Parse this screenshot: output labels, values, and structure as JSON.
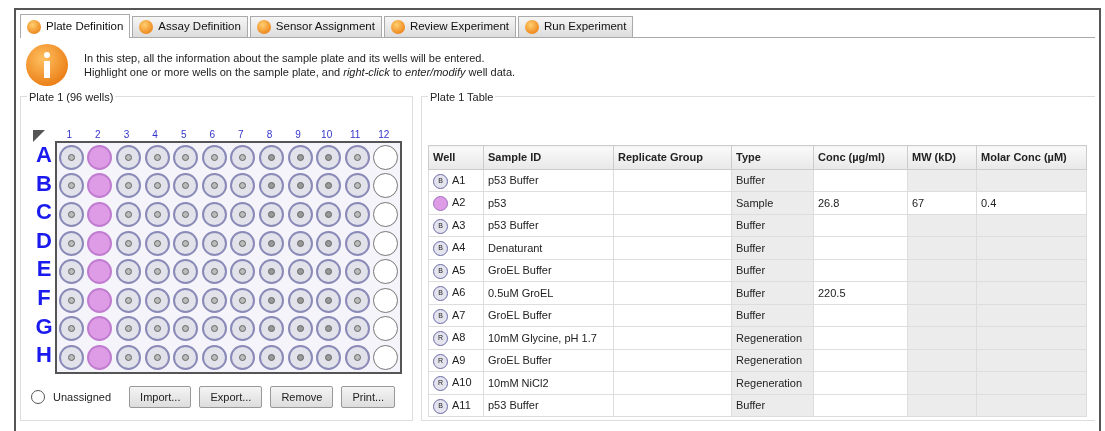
{
  "tabs": [
    {
      "label": "Plate Definition",
      "selected": true
    },
    {
      "label": "Assay Definition",
      "selected": false
    },
    {
      "label": "Sensor Assignment",
      "selected": false
    },
    {
      "label": "Review Experiment",
      "selected": false
    },
    {
      "label": "Run Experiment",
      "selected": false
    }
  ],
  "info": {
    "lines": [
      "In this step, all the information about the sample plate and its wells will be entered.",
      "Highlight one or more wells on the sample plate, and *right-click* to *enter/modify* well data."
    ]
  },
  "plate": {
    "title": "Plate 1 (96 wells)",
    "column_labels": [
      "1",
      "2",
      "3",
      "4",
      "5",
      "6",
      "7",
      "8",
      "9",
      "10",
      "11",
      "12"
    ],
    "row_labels": [
      "A",
      "B",
      "C",
      "D",
      "E",
      "F",
      "G",
      "H"
    ],
    "well_columns": [
      {
        "kind": "buffer"
      },
      {
        "kind": "sample"
      },
      {
        "kind": "buffer"
      },
      {
        "kind": "buffer"
      },
      {
        "kind": "buffer"
      },
      {
        "kind": "buffer"
      },
      {
        "kind": "buffer"
      },
      {
        "kind": "regeneration"
      },
      {
        "kind": "regeneration"
      },
      {
        "kind": "regeneration"
      },
      {
        "kind": "buffer"
      },
      {
        "kind": "empty"
      }
    ],
    "legend": "Unassigned",
    "buttons": [
      "Import...",
      "Export...",
      "Remove",
      "Print..."
    ]
  },
  "table": {
    "title": "Plate 1 Table",
    "columns": [
      {
        "label": "Well",
        "shaded": false
      },
      {
        "label": "Sample ID",
        "shaded": false
      },
      {
        "label": "Replicate Group",
        "shaded": false
      },
      {
        "label": "Type",
        "shaded": true
      },
      {
        "label": "Conc (µg/ml)",
        "shaded": false
      },
      {
        "label": "MW (kD)",
        "shaded": false
      },
      {
        "label": "Molar Conc (µM)",
        "shaded": false
      }
    ],
    "rows": [
      {
        "kind": "buffer",
        "mark": "B",
        "well": "A1",
        "sample_id": "p53 Buffer",
        "type": "Buffer"
      },
      {
        "kind": "sample",
        "well": "A2",
        "sample_id": "p53",
        "type": "Sample",
        "conc": "26.8",
        "mw": "67",
        "molar": "0.4"
      },
      {
        "kind": "buffer",
        "mark": "B",
        "well": "A3",
        "sample_id": "p53 Buffer",
        "type": "Buffer"
      },
      {
        "kind": "buffer",
        "mark": "B",
        "well": "A4",
        "sample_id": "Denaturant",
        "type": "Buffer"
      },
      {
        "kind": "buffer",
        "mark": "B",
        "well": "A5",
        "sample_id": "GroEL Buffer",
        "type": "Buffer"
      },
      {
        "kind": "buffer",
        "mark": "B",
        "well": "A6",
        "sample_id": "0.5uM GroEL",
        "type": "Buffer",
        "conc": "220.5"
      },
      {
        "kind": "buffer",
        "mark": "B",
        "well": "A7",
        "sample_id": "GroEL Buffer",
        "type": "Buffer"
      },
      {
        "kind": "regeneration",
        "mark": "R",
        "well": "A8",
        "sample_id": "10mM Glycine, pH 1.7",
        "type": "Regeneration"
      },
      {
        "kind": "regeneration",
        "mark": "R",
        "well": "A9",
        "sample_id": "GroEL Buffer",
        "type": "Regeneration"
      },
      {
        "kind": "regeneration",
        "mark": "R",
        "well": "A10",
        "sample_id": "10mM NiCl2",
        "type": "Regeneration"
      },
      {
        "kind": "buffer",
        "mark": "B",
        "well": "A11",
        "sample_id": "p53 Buffer",
        "type": "Buffer"
      }
    ]
  }
}
